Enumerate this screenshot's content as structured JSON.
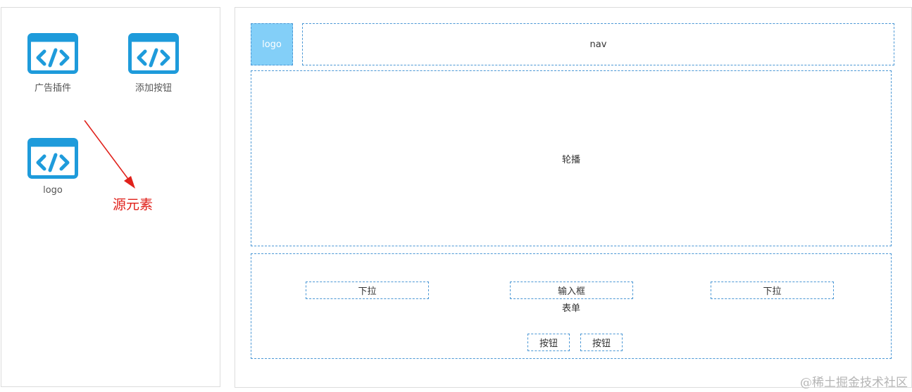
{
  "palette": {
    "components": [
      {
        "label": "广告插件",
        "icon": "code-window-icon"
      },
      {
        "label": "添加按钮",
        "icon": "code-window-icon"
      },
      {
        "label": "logo",
        "icon": "code-window-icon"
      }
    ],
    "annotation": "源元素"
  },
  "canvas": {
    "logo": "logo",
    "nav": "nav",
    "carousel": "轮播",
    "form": {
      "title": "表单",
      "dropdown_left": "下拉",
      "input": "输入框",
      "dropdown_right": "下拉",
      "button_1": "按钮",
      "button_2": "按钮"
    }
  },
  "watermark": "@稀土掘金技术社区",
  "colors": {
    "icon": "#1e9bdb",
    "dashed_border": "#4a97d5",
    "logo_fill": "#83cff8",
    "annotation": "#e0211b"
  }
}
